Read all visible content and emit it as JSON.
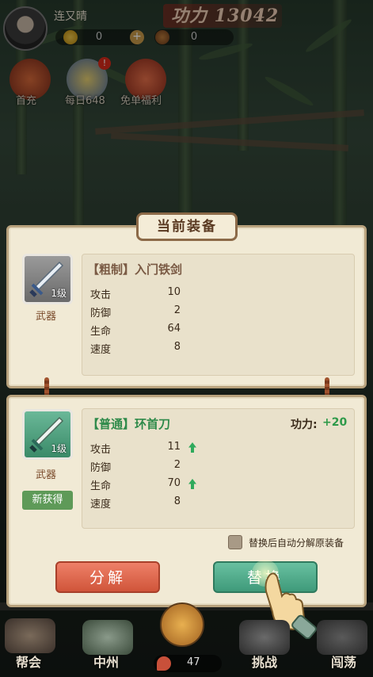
{
  "player": {
    "name": "连又晴",
    "power": "功力 13042"
  },
  "currencies": [
    {
      "icon": "gold-ingot-icon",
      "value": "0"
    },
    {
      "icon": "copper-coin-icon",
      "value": "0"
    }
  ],
  "events": [
    {
      "label": "首充",
      "badge": ""
    },
    {
      "label": "每日648",
      "badge": "!"
    },
    {
      "label": "免单福利",
      "badge": ""
    }
  ],
  "dialog": {
    "title": "当前装备",
    "current": {
      "level": "1级",
      "category": "武器",
      "name": "【粗制】入门铁剑",
      "name_color": "#7a5a44",
      "stats": [
        {
          "label": "攻击",
          "value": "10",
          "up": false
        },
        {
          "label": "防御",
          "value": "2",
          "up": false
        },
        {
          "label": "生命",
          "value": "64",
          "up": false
        },
        {
          "label": "速度",
          "value": "8",
          "up": false
        }
      ]
    },
    "new": {
      "level": "1级",
      "category": "武器",
      "tag": "新获得",
      "name": "【普通】环首刀",
      "name_color": "#2e8a4a",
      "power_label": "功力:",
      "power_delta": "+20",
      "stats": [
        {
          "label": "攻击",
          "value": "11",
          "up": true
        },
        {
          "label": "防御",
          "value": "2",
          "up": false
        },
        {
          "label": "生命",
          "value": "70",
          "up": true
        },
        {
          "label": "速度",
          "value": "8",
          "up": false
        }
      ]
    },
    "auto_decompose_label": "替换后自动分解原装备",
    "auto_decompose_checked": false,
    "decompose_label": "分解",
    "replace_label": "替换"
  },
  "bottom_nav": [
    {
      "label": "帮会"
    },
    {
      "label": "中州"
    },
    {
      "label": "",
      "value": "47"
    },
    {
      "label": "挑战"
    },
    {
      "label": "闯荡"
    }
  ],
  "colors": {
    "decompose": "#e06a4e",
    "replace": "#4fae8f",
    "new_slot": "#4a9a78",
    "old_slot": "#8a8a8a",
    "tag_bg": "#5e9a58"
  }
}
